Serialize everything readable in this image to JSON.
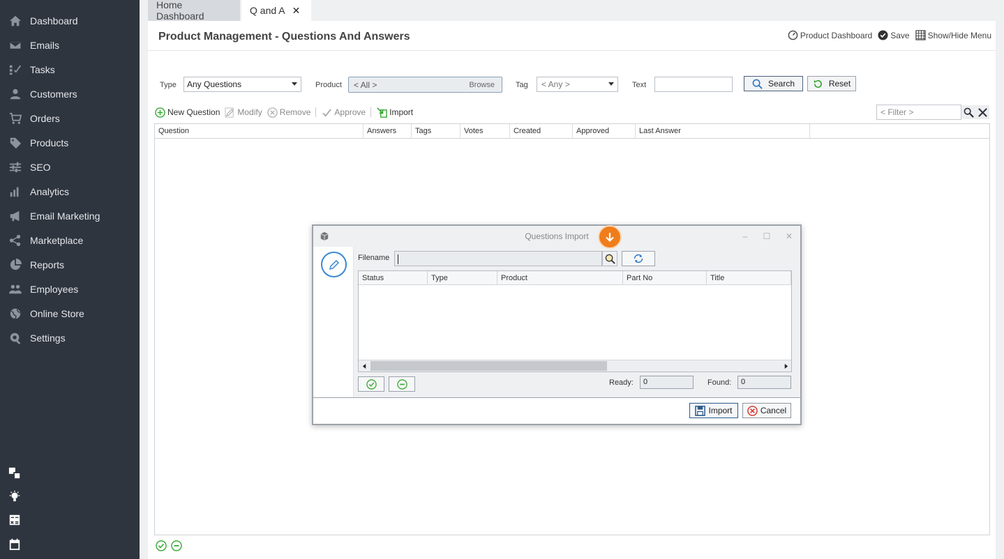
{
  "sidebar": {
    "items": [
      {
        "label": "Dashboard",
        "icon": "home-icon"
      },
      {
        "label": "Emails",
        "icon": "envelope-icon"
      },
      {
        "label": "Tasks",
        "icon": "tasks-icon"
      },
      {
        "label": "Customers",
        "icon": "user-icon"
      },
      {
        "label": "Orders",
        "icon": "cart-icon"
      },
      {
        "label": "Products",
        "icon": "tag-icon"
      },
      {
        "label": "SEO",
        "icon": "sliders-icon"
      },
      {
        "label": "Analytics",
        "icon": "bar-chart-icon"
      },
      {
        "label": "Email Marketing",
        "icon": "megaphone-icon"
      },
      {
        "label": "Marketplace",
        "icon": "share-icon"
      },
      {
        "label": "Reports",
        "icon": "pie-chart-icon"
      },
      {
        "label": "Employees",
        "icon": "users-icon"
      },
      {
        "label": "Online Store",
        "icon": "globe-icon"
      },
      {
        "label": "Settings",
        "icon": "settings-icon"
      }
    ],
    "bottom_icons": [
      "windows-icon",
      "lightbulb-icon",
      "calculator-icon",
      "calendar-icon"
    ]
  },
  "tabs": {
    "home": "Home Dashboard",
    "qa": "Q and A",
    "qa_close": "✕"
  },
  "header": {
    "title": "Product Management - Questions And Answers",
    "actions": {
      "product_dashboard": "Product Dashboard",
      "save": "Save",
      "show_hide_menu": "Show/Hide Menu"
    }
  },
  "filters": {
    "type_label": "Type",
    "type_value": "Any Questions",
    "product_label": "Product",
    "product_value": "< All >",
    "browse": "Browse",
    "tag_label": "Tag",
    "tag_value": "< Any >",
    "text_label": "Text",
    "text_value": "",
    "search_button": "Search",
    "reset_button": "Reset"
  },
  "toolbar": {
    "new_question": "New Question",
    "modify": "Modify",
    "remove": "Remove",
    "approve": "Approve",
    "import": "Import",
    "filter_placeholder": "< Filter >"
  },
  "grid": {
    "columns": [
      "Question",
      "Answers",
      "Tags",
      "Votes",
      "Created",
      "Approved",
      "Last Answer"
    ]
  },
  "dialog": {
    "title": "Questions Import",
    "filename_label": "Filename",
    "filename_value": "",
    "columns": [
      "Status",
      "Type",
      "Product",
      "Part No",
      "Title"
    ],
    "ready_label": "Ready:",
    "ready_value": "0",
    "found_label": "Found:",
    "found_value": "0",
    "import_button": "Import",
    "cancel_button": "Cancel",
    "minimize": "–",
    "maximize": "☐",
    "close": "✕"
  },
  "colors": {
    "sidebar_bg": "#2f353f",
    "accent_blue": "#3b88d4",
    "accent_green": "#3aa935",
    "accent_orange": "#f07d1b",
    "danger_red": "#d9302b"
  }
}
